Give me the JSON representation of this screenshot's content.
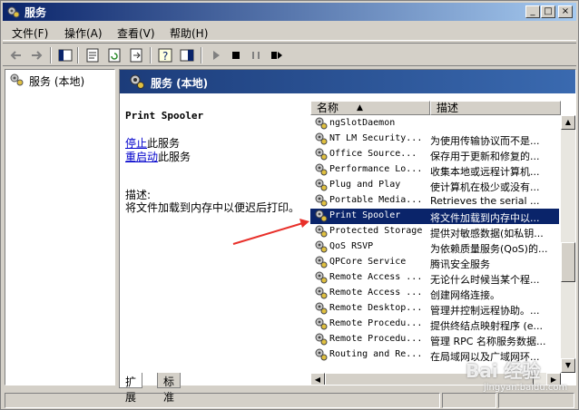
{
  "window": {
    "title": "服务",
    "min": "_",
    "max": "□",
    "close": "×"
  },
  "menu": [
    "文件(F)",
    "操作(A)",
    "查看(V)",
    "帮助(H)"
  ],
  "tree": {
    "root": "服务 (本地)"
  },
  "header": {
    "title": "服务 (本地)"
  },
  "detail": {
    "service_name": "Print Spooler",
    "stop_link": "停止",
    "stop_suffix": "此服务",
    "restart_link": "重启动",
    "restart_suffix": "此服务",
    "desc_label": "描述:",
    "desc_text": "将文件加载到内存中以便迟后打印。"
  },
  "list": {
    "col_name": "名称",
    "col_desc": "描述",
    "rows": [
      {
        "name": "ngSlotDaemon",
        "desc": ""
      },
      {
        "name": "NT LM Security...",
        "desc": "为使用传输协议而不是..."
      },
      {
        "name": "Office  Source...",
        "desc": "保存用于更新和修复的..."
      },
      {
        "name": "Performance Lo...",
        "desc": "收集本地或远程计算机..."
      },
      {
        "name": "Plug and Play",
        "desc": "使计算机在极少或没有..."
      },
      {
        "name": "Portable Media...",
        "desc": "Retrieves the serial ..."
      },
      {
        "name": "Print Spooler",
        "desc": "将文件加载到内存中以..."
      },
      {
        "name": "Protected Storage",
        "desc": "提供对敏感数据(如私钥..."
      },
      {
        "name": "QoS RSVP",
        "desc": "为依赖质量服务(QoS)的..."
      },
      {
        "name": "QPCore Service",
        "desc": "腾讯安全服务"
      },
      {
        "name": "Remote Access ...",
        "desc": "无论什么时候当某个程..."
      },
      {
        "name": "Remote Access ...",
        "desc": "创建网络连接。"
      },
      {
        "name": "Remote Desktop...",
        "desc": "管理并控制远程协助。..."
      },
      {
        "name": "Remote Procedu...",
        "desc": "提供终结点映射程序 (e..."
      },
      {
        "name": "Remote Procedu...",
        "desc": "管理 RPC 名称服务数据..."
      },
      {
        "name": "Routing and Re...",
        "desc": "在局域网以及广域网环..."
      }
    ],
    "selected_index": 6
  },
  "tabs": [
    "扩展",
    "标准"
  ],
  "watermark": {
    "main": "Bai 经验",
    "sub": "jingyan.baidu.com"
  },
  "colors": {
    "title_start": "#0a246a",
    "header_bg": "#2f4f8f",
    "selected": "#0a246a",
    "arrow": "#e8302a"
  }
}
